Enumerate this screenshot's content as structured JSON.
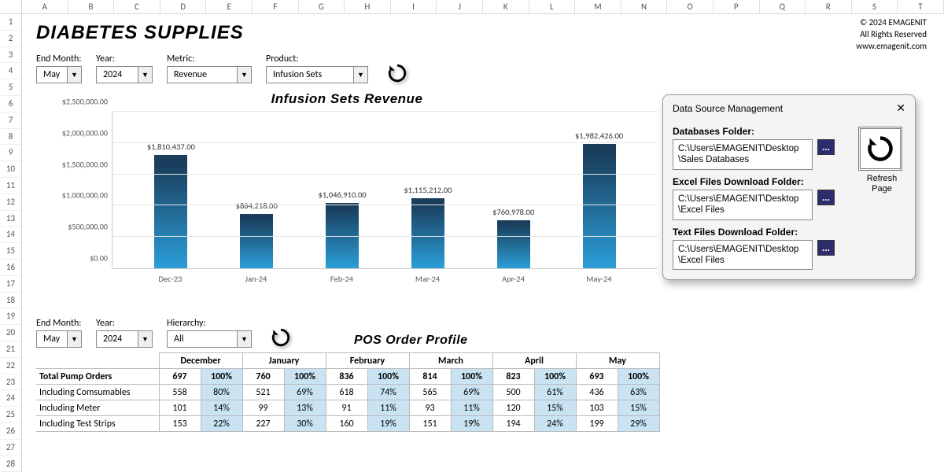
{
  "cols": [
    "A",
    "B",
    "C",
    "D",
    "E",
    "F",
    "G",
    "H",
    "I",
    "J",
    "K",
    "L",
    "M",
    "N",
    "O",
    "P",
    "Q",
    "R",
    "S",
    "T"
  ],
  "rows": [
    "1",
    "2",
    "3",
    "4",
    "5",
    "6",
    "7",
    "8",
    "9",
    "10",
    "11",
    "12",
    "13",
    "14",
    "15",
    "16",
    "17",
    "18",
    "19",
    "20",
    "21",
    "22",
    "23",
    "24",
    "25",
    "26",
    "27",
    "28"
  ],
  "title": "DIABETES SUPPLIES",
  "copyright": {
    "l1": "© 2024 EMAGENIT",
    "l2": "All Rights Reserved",
    "l3": "www.emagenit.com"
  },
  "controls1": {
    "end_month_label": "End Month:",
    "end_month": "May",
    "year_label": "Year:",
    "year": "2024",
    "metric_label": "Metric:",
    "metric": "Revenue",
    "product_label": "Product:",
    "product": "Infusion Sets"
  },
  "chart_data": {
    "type": "bar",
    "title": "Infusion Sets Revenue",
    "categories": [
      "Dec-23",
      "Jan-24",
      "Feb-24",
      "Mar-24",
      "Apr-24",
      "May-24"
    ],
    "values": [
      1810437.0,
      864218.0,
      1046910.0,
      1115212.0,
      760978.0,
      1982426.0
    ],
    "value_labels": [
      "$1,810,437.00",
      "$864,218.00",
      "$1,046,910.00",
      "$1,115,212.00",
      "$760,978.00",
      "$1,982,426.00"
    ],
    "y_ticks": [
      "$0.00",
      "$500,000.00",
      "$1,000,000.00",
      "$1,500,000.00",
      "$2,000,000.00",
      "$2,500,000.00"
    ],
    "ylim": [
      0,
      2500000
    ],
    "xlabel": "",
    "ylabel": ""
  },
  "controls2": {
    "end_month_label": "End Month:",
    "end_month": "May",
    "year_label": "Year:",
    "year": "2024",
    "hierarchy_label": "Hierarchy:",
    "hierarchy": "All"
  },
  "pos": {
    "title": "POS Order Profile",
    "months": [
      "December",
      "January",
      "February",
      "March",
      "April",
      "May"
    ],
    "rows": [
      {
        "label": "Total Pump Orders",
        "bold": true,
        "vals": [
          697,
          760,
          836,
          814,
          823,
          693
        ],
        "pcts": [
          "100%",
          "100%",
          "100%",
          "100%",
          "100%",
          "100%"
        ]
      },
      {
        "label": "Including Comsumables",
        "vals": [
          558,
          521,
          618,
          565,
          500,
          436
        ],
        "pcts": [
          "80%",
          "69%",
          "74%",
          "69%",
          "61%",
          "63%"
        ]
      },
      {
        "label": "Including Meter",
        "vals": [
          101,
          99,
          91,
          93,
          120,
          103
        ],
        "pcts": [
          "14%",
          "13%",
          "11%",
          "11%",
          "15%",
          "15%"
        ]
      },
      {
        "label": "Including Test Strips",
        "vals": [
          153,
          227,
          160,
          151,
          194,
          199
        ],
        "pcts": [
          "22%",
          "30%",
          "19%",
          "19%",
          "24%",
          "29%"
        ]
      }
    ]
  },
  "dialog": {
    "title": "Data Source Management",
    "db_label": "Databases Folder:",
    "db_path": "C:\\Users\\EMAGENIT\\Desktop\\Sales Databases",
    "excel_label": "Excel Files Download Folder:",
    "excel_path": "C:\\Users\\EMAGENIT\\Desktop\\Excel Files",
    "text_label": "Text Files Download Folder:",
    "text_path": "C:\\Users\\EMAGENIT\\Desktop\\Excel Files",
    "browse": "...",
    "refresh_caption": "Refresh Page"
  }
}
